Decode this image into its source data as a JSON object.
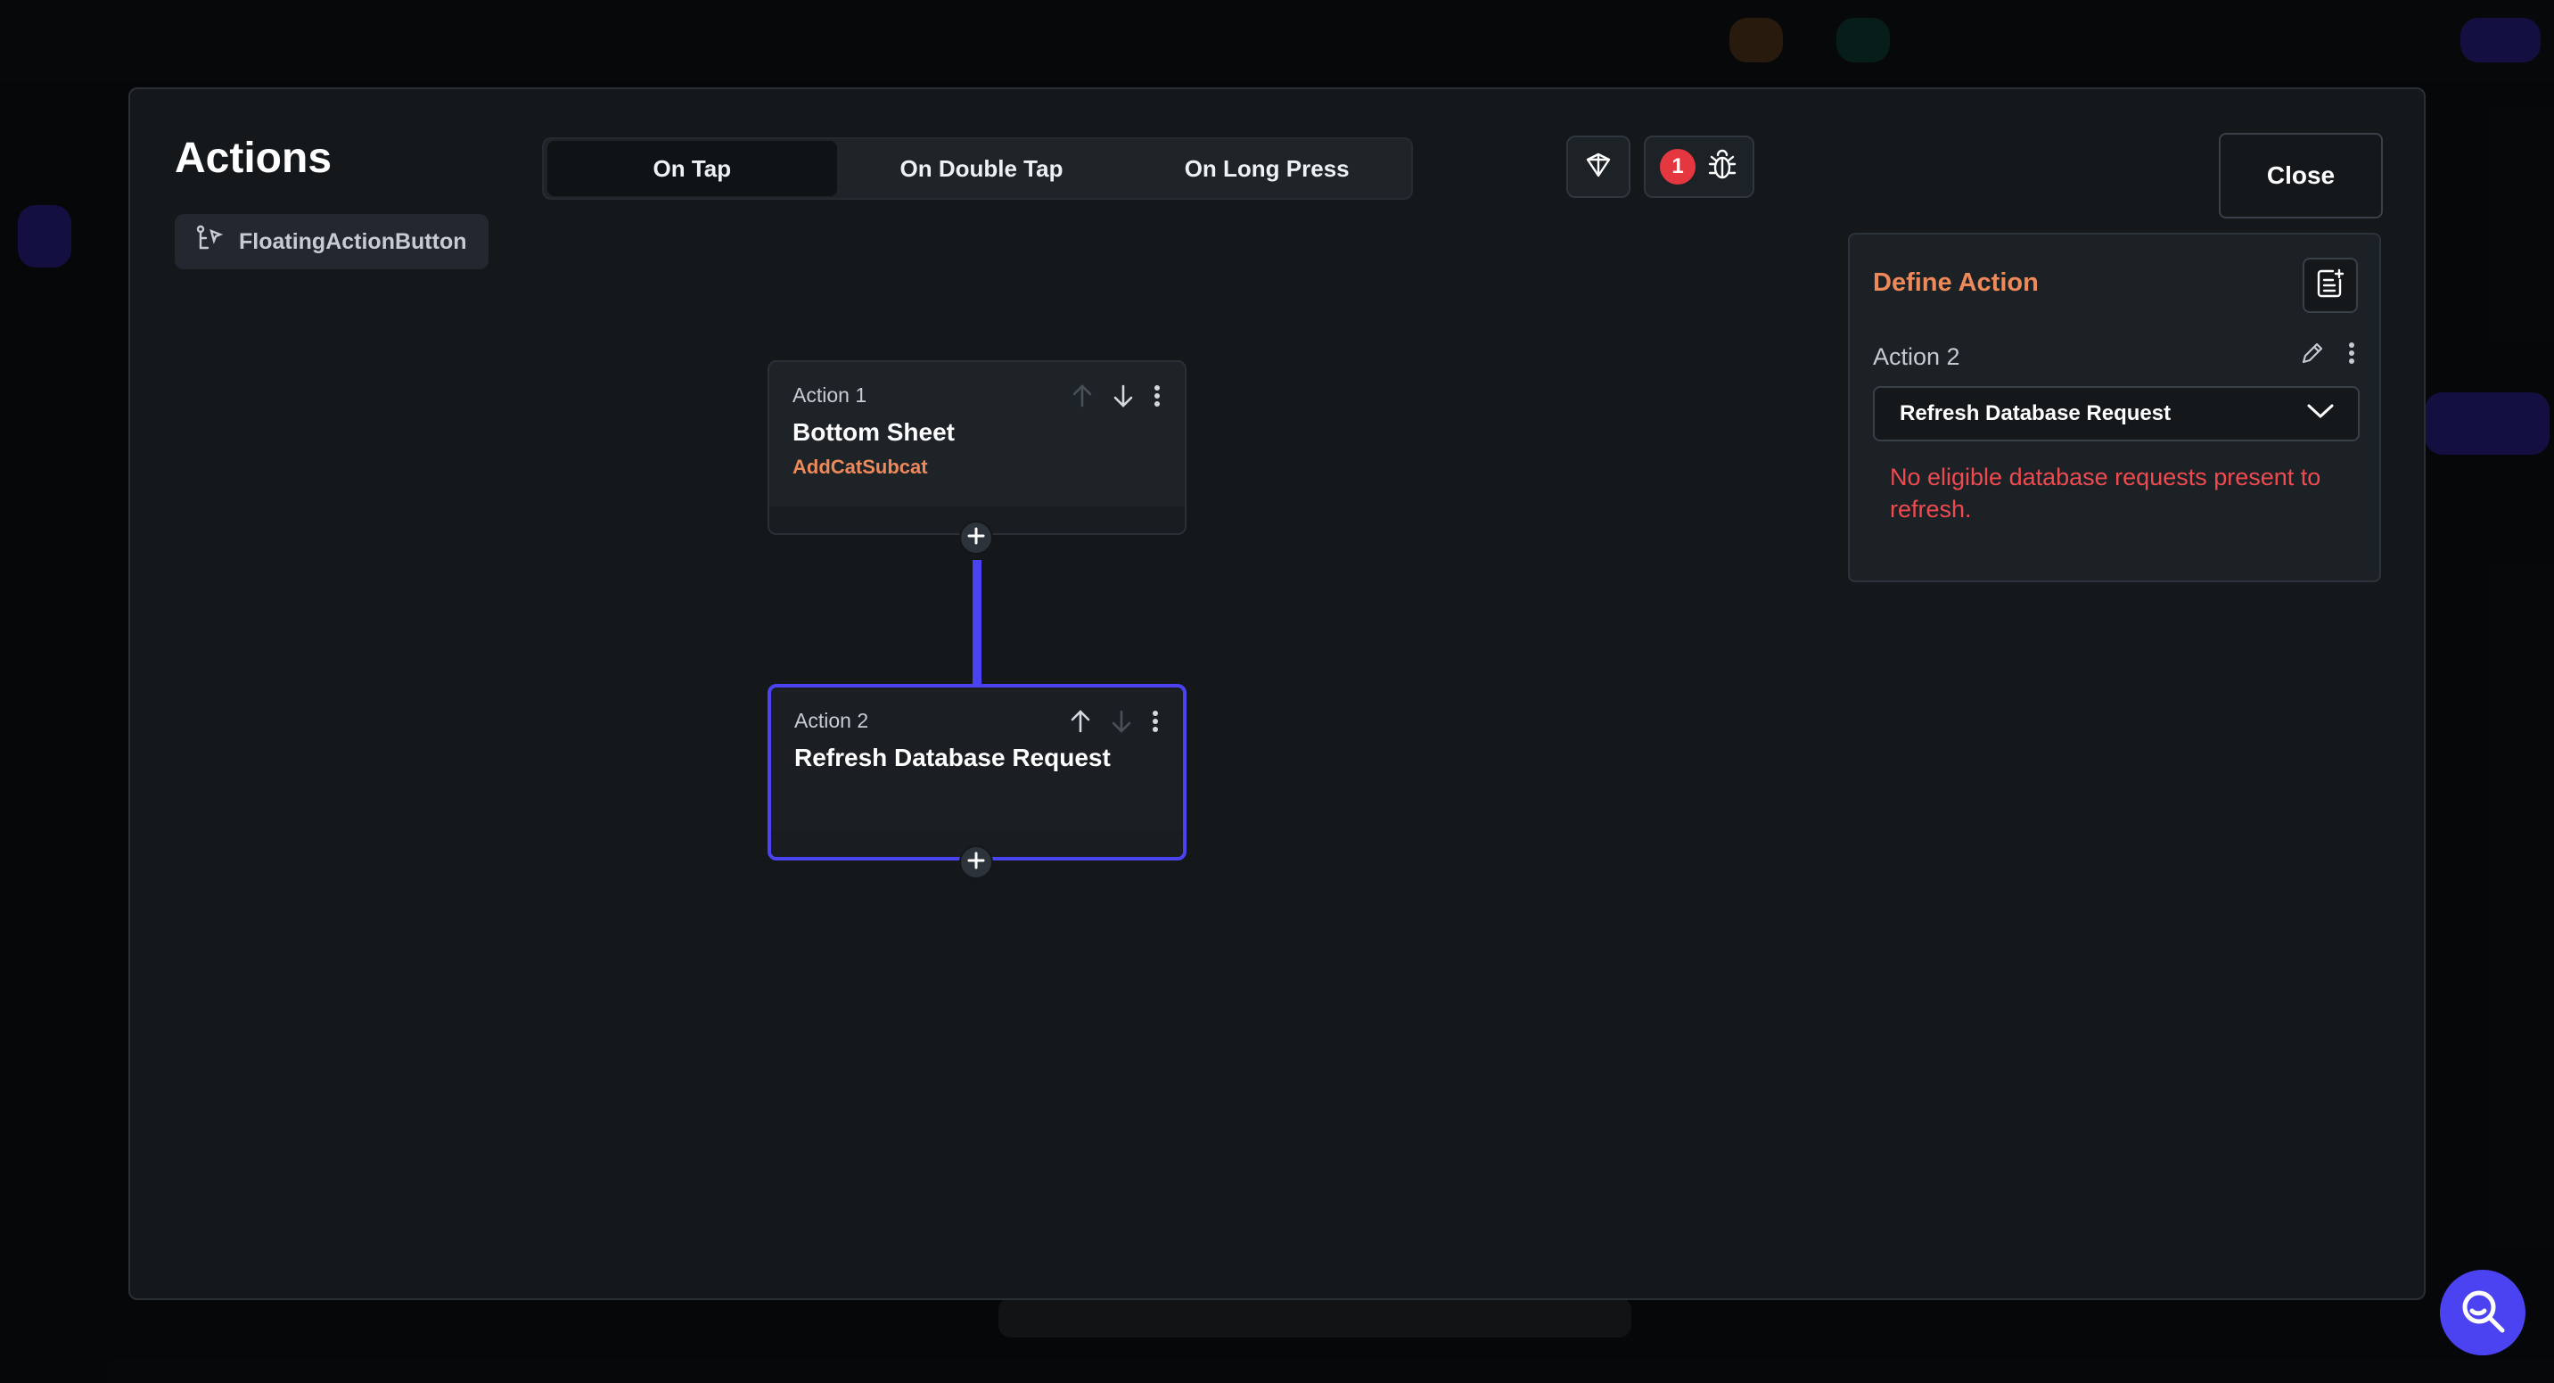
{
  "modal": {
    "title": "Actions",
    "widget_name": "FloatingActionButton",
    "tabs": [
      {
        "label": "On Tap",
        "active": true
      },
      {
        "label": "On Double Tap",
        "active": false
      },
      {
        "label": "On Long Press",
        "active": false
      }
    ],
    "issue_count": "1",
    "close_label": "Close"
  },
  "actions": [
    {
      "label": "Action 1",
      "name": "Bottom Sheet",
      "sub": "AddCatSubcat",
      "selected": false
    },
    {
      "label": "Action 2",
      "name": "Refresh Database Request",
      "sub": "",
      "selected": true
    }
  ],
  "define_action": {
    "title": "Define Action",
    "action_label": "Action 2",
    "selected_value": "Refresh Database Request",
    "error": "No eligible database requests present to refresh."
  },
  "colors": {
    "accent": "#4b43f2",
    "orange": "#ee8a5a",
    "error": "#ef4a4f",
    "badge": "#e5373f"
  },
  "icons": [
    "widget-tree-icon",
    "ai-gem-icon",
    "bug-icon",
    "arrow-up-icon",
    "arrow-down-icon",
    "more-vertical-icon",
    "plus-icon",
    "add-note-icon",
    "edit-icon",
    "chevron-down-icon",
    "search-icon"
  ]
}
